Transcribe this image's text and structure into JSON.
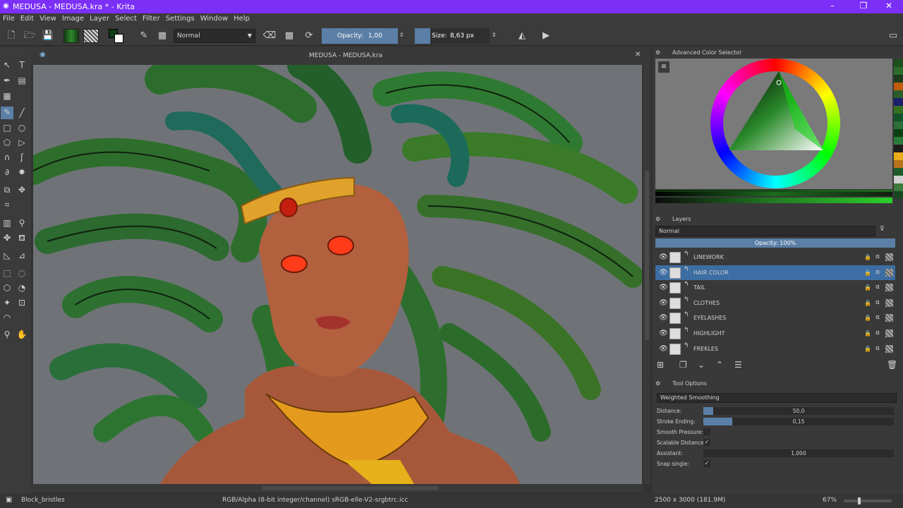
{
  "window": {
    "title": "MEDUSA - MEDUSA.kra * - Krita"
  },
  "menu": [
    "File",
    "Edit",
    "View",
    "Image",
    "Layer",
    "Select",
    "Filter",
    "Settings",
    "Window",
    "Help"
  ],
  "toolbar": {
    "blend_mode": "Normal",
    "opacity_label": "Opacity:",
    "opacity_value": "1,00",
    "size_label": "Size:",
    "size_value": "8,63 px"
  },
  "canvas": {
    "tab_title": "MEDUSA - MEDUSA.kra"
  },
  "color_selector": {
    "title": "Advanced Color Selector"
  },
  "layers_panel": {
    "title": "Layers",
    "blend_mode": "Normal",
    "opacity": "Opacity:  100%",
    "layers": [
      {
        "name": "LINEWORK",
        "selected": false
      },
      {
        "name": "HAIR COLOR",
        "selected": true
      },
      {
        "name": "TAIL",
        "selected": false
      },
      {
        "name": "CLOTHES",
        "selected": false
      },
      {
        "name": "EYELASHES",
        "selected": false
      },
      {
        "name": "HIGHLIGHT",
        "selected": false
      },
      {
        "name": "FREKLES",
        "selected": false
      }
    ]
  },
  "tool_options": {
    "title": "Tool Options",
    "smoothing": "Weighted Smoothing",
    "rows": [
      {
        "label": "Distance:",
        "value": "50,0",
        "fill": 0.05
      },
      {
        "label": "Stroke Ending:",
        "value": "0,15",
        "fill": 0.15
      },
      {
        "label": "Smooth Pressure:",
        "value": "",
        "fill": 0
      },
      {
        "label": "Scalable Distance:",
        "value": "✓",
        "fill": 0
      },
      {
        "label": "Assistant:",
        "value": "1,000",
        "fill": 0
      },
      {
        "label": "Snap single:",
        "value": "✓",
        "fill": 0
      }
    ]
  },
  "status": {
    "brush": "Block_bristles",
    "color_info": "RGB/Alpha (8-bit integer/channel)  sRGB-elle-V2-srgbtrc.icc",
    "dimensions": "2500 x 3000 (181.9M)",
    "zoom": "67%"
  },
  "palette_colors": [
    "#1c4f1c",
    "#2d6d2b",
    "#1d3b1c",
    "#c05b0e",
    "#2b5e2a",
    "#1d1d6d",
    "#35701f",
    "#12512a",
    "#2d6e38",
    "#0d3f14",
    "#2c7a3a",
    "#1d1d1d",
    "#e8ad1a",
    "#b8721e",
    "#1d5c2a",
    "#d0d0d0",
    "#3d7a3c",
    "#19461f"
  ]
}
